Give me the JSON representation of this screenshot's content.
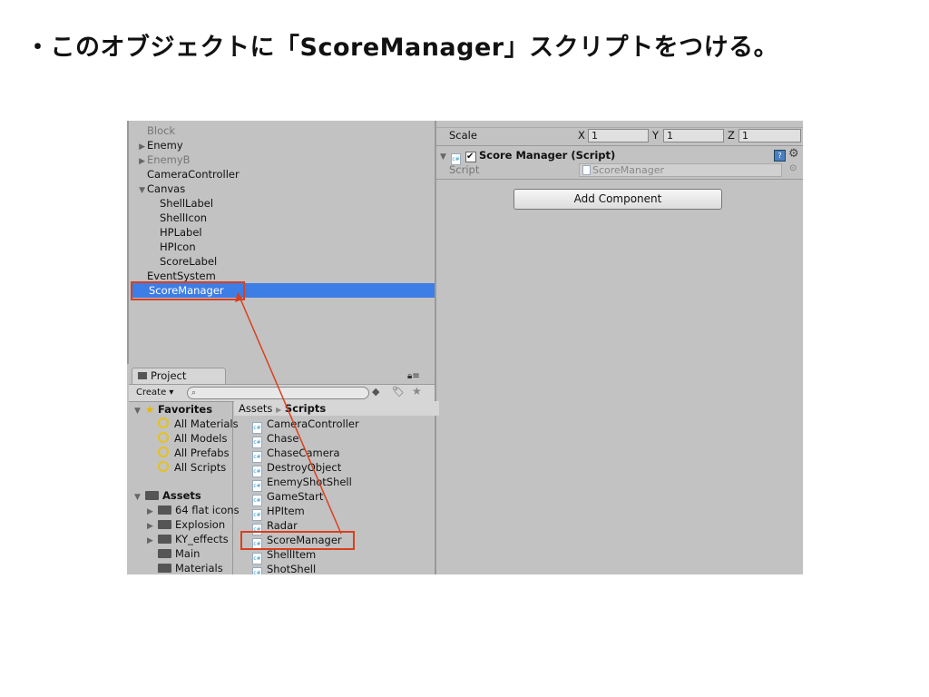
{
  "slide": {
    "title": "・このオブジェクトに「ScoreManager」スクリプトをつける。"
  },
  "hierarchy": {
    "items": [
      {
        "label": "Block",
        "indent": 0,
        "arrow": "",
        "dim": true
      },
      {
        "label": "Enemy",
        "indent": 0,
        "arrow": "right",
        "dim": false
      },
      {
        "label": "EnemyB",
        "indent": 0,
        "arrow": "right",
        "dim": true
      },
      {
        "label": "CameraController",
        "indent": 0,
        "arrow": "",
        "dim": false
      },
      {
        "label": "Canvas",
        "indent": 0,
        "arrow": "down",
        "dim": false
      },
      {
        "label": "ShellLabel",
        "indent": 1,
        "arrow": "",
        "dim": false
      },
      {
        "label": "ShellIcon",
        "indent": 1,
        "arrow": "",
        "dim": false
      },
      {
        "label": "HPLabel",
        "indent": 1,
        "arrow": "",
        "dim": false
      },
      {
        "label": "HPIcon",
        "indent": 1,
        "arrow": "",
        "dim": false
      },
      {
        "label": "ScoreLabel",
        "indent": 1,
        "arrow": "",
        "dim": false
      },
      {
        "label": "EventSystem",
        "indent": 0,
        "arrow": "",
        "dim": false
      },
      {
        "label": "ScoreManager",
        "indent": 0,
        "arrow": "",
        "dim": false,
        "selected": true
      }
    ]
  },
  "inspector": {
    "scale_label": "Scale",
    "x_label": "X",
    "y_label": "Y",
    "z_label": "Z",
    "scale_x": "1",
    "scale_y": "1",
    "scale_z": "1",
    "component_title": "Score Manager (Script)",
    "script_label": "Script",
    "script_value": "ScoreManager",
    "add_component": "Add Component"
  },
  "project": {
    "tab": "Project",
    "create": "Create ▾",
    "favorites_label": "Favorites",
    "favorites": [
      "All Materials",
      "All Models",
      "All Prefabs",
      "All Scripts"
    ],
    "assets_label": "Assets",
    "folders": [
      {
        "label": "64 flat icons",
        "arrow": true
      },
      {
        "label": "Explosion",
        "arrow": true
      },
      {
        "label": "KY_effects",
        "arrow": true
      },
      {
        "label": "Main",
        "arrow": false
      },
      {
        "label": "Materials",
        "arrow": false
      }
    ],
    "breadcrumb_root": "Assets",
    "breadcrumb_current": "Scripts",
    "scripts": [
      "CameraController",
      "Chase",
      "ChaseCamera",
      "DestroyObject",
      "EnemyShotShell",
      "GameStart",
      "HPItem",
      "Radar",
      "ScoreManager",
      "ShellItem",
      "ShotShell"
    ]
  },
  "colors": {
    "selection": "#3d7de6",
    "annotation": "#d9401e"
  }
}
